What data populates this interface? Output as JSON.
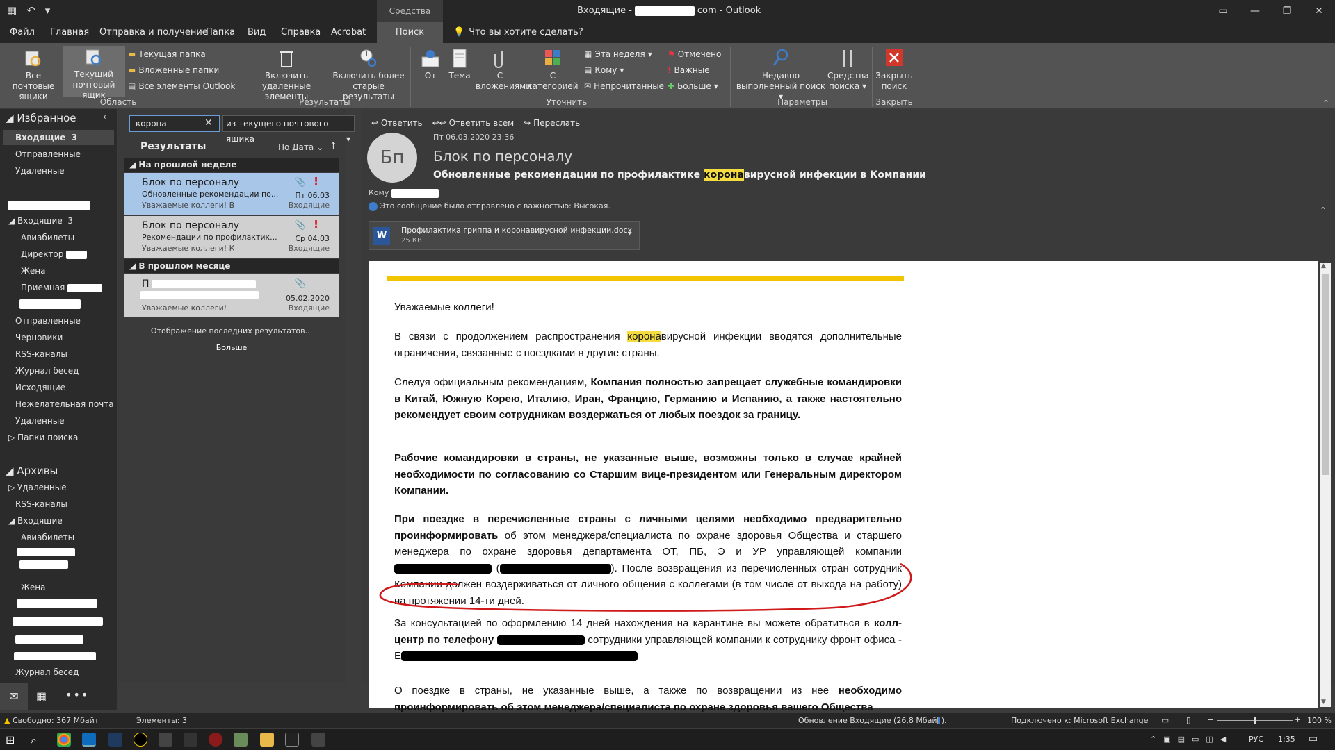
{
  "titlebar": {
    "context_tab": "Средства поиска",
    "title_prefix": "Входящие -",
    "title_suffix": "com - Outlook"
  },
  "menu_tabs": [
    "Файл",
    "Главная",
    "Отправка и получение",
    "Папка",
    "Вид",
    "Справка",
    "Acrobat",
    "Поиск"
  ],
  "tell_me": "Что вы хотите сделать?",
  "ribbon": {
    "scope": {
      "all_mailboxes": "Все почтовые ящики",
      "current_mailbox": "Текущий почтовый ящик",
      "current_folder": "Текущая папка",
      "subfolders": "Вложенные папки",
      "all_outlook": "Все элементы Outlook",
      "group": "Область"
    },
    "results": {
      "include_deleted": "Включить удаленные элементы",
      "include_older": "Включить более старые результаты",
      "group": "Результаты"
    },
    "refine": {
      "from": "От",
      "subject": "Тема",
      "with_attachments": "С вложениями",
      "categorized": "С категорией",
      "this_week": "Эта неделя",
      "to": "Кому",
      "unread": "Непрочитанные",
      "flagged": "Отмечено",
      "important": "Важные",
      "more": "Больше",
      "group": "Уточнить"
    },
    "options": {
      "recent": "Недавно выполненный поиск",
      "tools": "Средства поиска",
      "group": "Параметры"
    },
    "close": {
      "close_search": "Закрыть поиск",
      "group": "Закрыть"
    }
  },
  "nav": {
    "favorites": "Избранное",
    "fav_items": [
      {
        "label": "Входящие",
        "count": "3"
      },
      {
        "label": "Отправленные"
      },
      {
        "label": "Удаленные"
      }
    ],
    "inbox": "Входящие",
    "inbox_count": "3",
    "inbox_sub": [
      "Авиабилеты",
      "Директор",
      "Жена",
      "Приемная"
    ],
    "folders": [
      "Отправленные",
      "Черновики",
      "RSS-каналы",
      "Журнал бесед",
      "Исходящие",
      "Нежелательная почта",
      "Удаленные",
      "Папки поиска"
    ],
    "archives": "Архивы",
    "archive_items": [
      "Удаленные",
      "RSS-каналы",
      "Входящие"
    ],
    "archive_inbox_sub": [
      "Авиабилеты",
      "Жена"
    ],
    "archive_last": "Журнал бесед"
  },
  "search": {
    "query": "корона",
    "scope": "из текущего почтового ящика"
  },
  "results": {
    "title": "Результаты",
    "sort": "По Дата",
    "groups": [
      {
        "label": "На прошлой неделе"
      },
      {
        "label": "В прошлом месяце"
      }
    ],
    "items": [
      {
        "from": "Блок по персоналу",
        "subject": "Обновленные рекомендации по...",
        "preview": "Уважаемые коллеги!  В",
        "date": "Пт 06.03",
        "folder": "Входящие"
      },
      {
        "from": "Блок по персоналу",
        "subject": "Рекомендации по профилактик...",
        "preview": "Уважаемые коллеги!  К",
        "date": "Ср 04.03",
        "folder": "Входящие"
      },
      {
        "from": "П",
        "subject": "",
        "preview": "Уважаемые коллеги!",
        "date": "05.02.2020",
        "folder": "Входящие"
      }
    ],
    "loading": "Отображение последних результатов...",
    "more": "Больше"
  },
  "reading": {
    "actions": [
      "Ответить",
      "Ответить всем",
      "Переслать"
    ],
    "datetime": "Пт 06.03.2020 23:36",
    "avatar": "Бп",
    "sender": "Блок по персоналу",
    "subject_pre": "Обновленные рекомендации по профилактике ",
    "subject_hl": "корона",
    "subject_post": "вирусной инфекции в Компании",
    "to_label": "Кому",
    "importance": "Это сообщение было отправлено с важностью: Высокая.",
    "attachment": {
      "name": "Профилактика гриппа и коронавирусной инфекции.docx",
      "size": "25 КВ"
    }
  },
  "body": {
    "greeting": "Уважаемые коллеги!",
    "p1_pre": "В связи с продолжением распространения ",
    "p1_hl": "корона",
    "p1_post": "вирусной инфекции вводятся дополнительные ограничения, связанные с поездками в другие страны.",
    "p2_pre": "Следуя официальным рекомендациям, ",
    "p2_bold": "Компания полностью запрещает служебные командировки в Китай, Южную Корею, Италию, Иран, Францию, Германию и Испанию, а также настоятельно рекомендует своим сотрудникам воздержаться от любых поездок за границу.",
    "p3": "Рабочие командировки в страны, не указанные выше, возможны только в случае крайней необходимости по согласованию со Старшим вице-президентом или Генеральным директором Компании.",
    "p4_bold": "При поездке в перечисленные страны с личными целями необходимо предварительно проинформировать",
    "p4_rest": " об этом менеджера/специалиста по охране здоровья Общества и старшего менеджера по охране здоровья департамента ОТ, ПБ, Э и УР управляющей компании",
    "p4_after": "). После возвращения из перечисленных стран сотрудник Компании должен воздерживаться от личного общения с коллегами (в том числе от выхода на работу) на протяжении 14-ти дней.",
    "p5_pre": "За консультацией по оформлению 14 дней нахождения на карантине вы можете обратиться в ",
    "p5_bold": "колл-центр по телефону",
    "p5_mid": " сотрудники управляющей компании к сотруднику фронт офиса  - E",
    "p6_pre": "О поездке в страны, не указанные выше, а также по возвращении из нее ",
    "p6_bold": "необходимо проинформировать об этом менеджера/специалиста по охране здоровья вашего Общества"
  },
  "status": {
    "free": "Свободно: 367 Мбайт",
    "items": "Элементы: 3",
    "update": "Обновление Входящие (26,8 Мбайт).",
    "connection": "Подключено к: Microsoft Exchange",
    "zoom": "100 %"
  },
  "taskbar": {
    "lang": "РУС",
    "time": "1:35"
  },
  "colors": {
    "accent": "#f2c500",
    "highlight": "#f5dc40",
    "selected_mail": "#a8c6e8",
    "annotation": "#d0191a"
  }
}
